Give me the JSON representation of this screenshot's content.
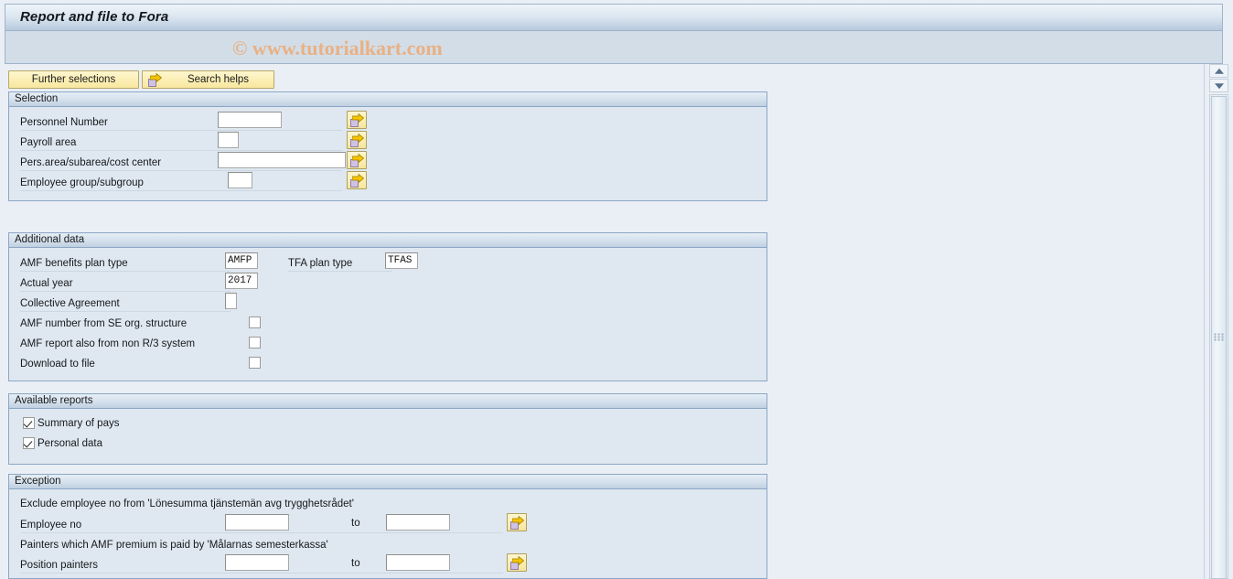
{
  "window": {
    "title": "Report and file to Fora",
    "watermark": "© www.tutorialkart.com"
  },
  "toolbar": {
    "further_selections_label": "Further selections",
    "search_helps_label": "Search helps"
  },
  "sections": {
    "selection": {
      "header": "Selection",
      "rows": [
        {
          "label": "Personnel Number",
          "value": ""
        },
        {
          "label": "Payroll area",
          "value": ""
        },
        {
          "label": "Pers.area/subarea/cost center",
          "value": ""
        },
        {
          "label": "Employee group/subgroup",
          "value": ""
        }
      ]
    },
    "additional_data": {
      "header": "Additional data",
      "amf_benefits_plan_type_label": "AMF benefits plan type",
      "amf_benefits_plan_type_value": "AMFP",
      "tfa_plan_type_label": "TFA plan type",
      "tfa_plan_type_value": "TFAS",
      "actual_year_label": "Actual year",
      "actual_year_value": "2017",
      "collective_agreement_label": "Collective Agreement",
      "collective_agreement_value": "",
      "checkboxes": [
        {
          "label": "AMF number from SE org. structure",
          "checked": false
        },
        {
          "label": "AMF report also from non R/3 system",
          "checked": false
        },
        {
          "label": "Download to file",
          "checked": false
        }
      ]
    },
    "available_reports": {
      "header": "Available reports",
      "checkboxes": [
        {
          "label": "Summary of pays",
          "checked": true
        },
        {
          "label": "Personal data",
          "checked": true
        }
      ]
    },
    "exception": {
      "header": "Exception",
      "note_1": "Exclude employee no from 'Lönesumma tjänstemän avg trygghetsrådet'",
      "employee_no_label": "Employee no",
      "employee_no_from": "",
      "employee_no_to": "",
      "to_label_1": "to",
      "note_2": "Painters which AMF premium is paid by 'Målarnas semesterkassa'",
      "position_painters_label": "Position painters",
      "position_painters_from": "",
      "position_painters_to": "",
      "to_label_2": "to"
    }
  },
  "icons": {
    "multi_select": "multi-select-arrow-icon",
    "scroll_up": "scroll-up-arrow-icon",
    "scroll_down": "scroll-down-arrow-icon"
  }
}
